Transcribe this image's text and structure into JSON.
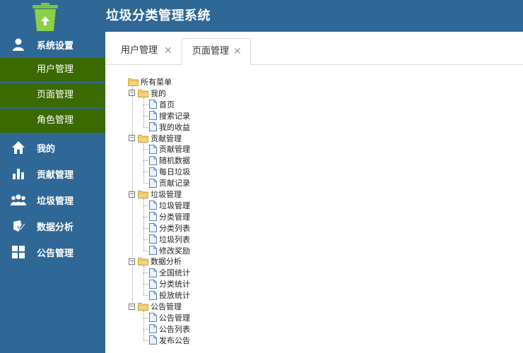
{
  "app": {
    "title": "垃圾分类管理系统"
  },
  "sidebar": {
    "items": [
      {
        "label": "系统设置",
        "icon": "user-icon"
      },
      {
        "label": "我的",
        "icon": "home-icon"
      },
      {
        "label": "贡献管理",
        "icon": "bar-chart-icon"
      },
      {
        "label": "垃圾管理",
        "icon": "group-icon"
      },
      {
        "label": "数据分析",
        "icon": "analysis-icon"
      },
      {
        "label": "公告管理",
        "icon": "grid-icon"
      }
    ],
    "sub_items": [
      {
        "label": "用户管理"
      },
      {
        "label": "页面管理"
      },
      {
        "label": "角色管理"
      }
    ],
    "sub_bg_color": "#3b6a00",
    "bg_color": "#2f6796"
  },
  "tabs": [
    {
      "label": "用户管理",
      "active": false
    },
    {
      "label": "页面管理",
      "active": true
    }
  ],
  "tree": {
    "root": "所有菜单",
    "groups": [
      {
        "label": "我的",
        "children": [
          "首页",
          "搜索记录",
          "我的收益"
        ]
      },
      {
        "label": "贡献管理",
        "children": [
          "贡献管理",
          "随机数据",
          "每日垃圾",
          "贡献记录"
        ]
      },
      {
        "label": "垃圾管理",
        "children": [
          "垃圾管理",
          "分类管理",
          "分类列表",
          "垃圾列表",
          "修改奖励"
        ]
      },
      {
        "label": "数据分析",
        "children": [
          "全国统计",
          "分类统计",
          "投放统计"
        ]
      },
      {
        "label": "公告管理",
        "children": [
          "公告管理",
          "公告列表",
          "发布公告"
        ]
      }
    ]
  }
}
